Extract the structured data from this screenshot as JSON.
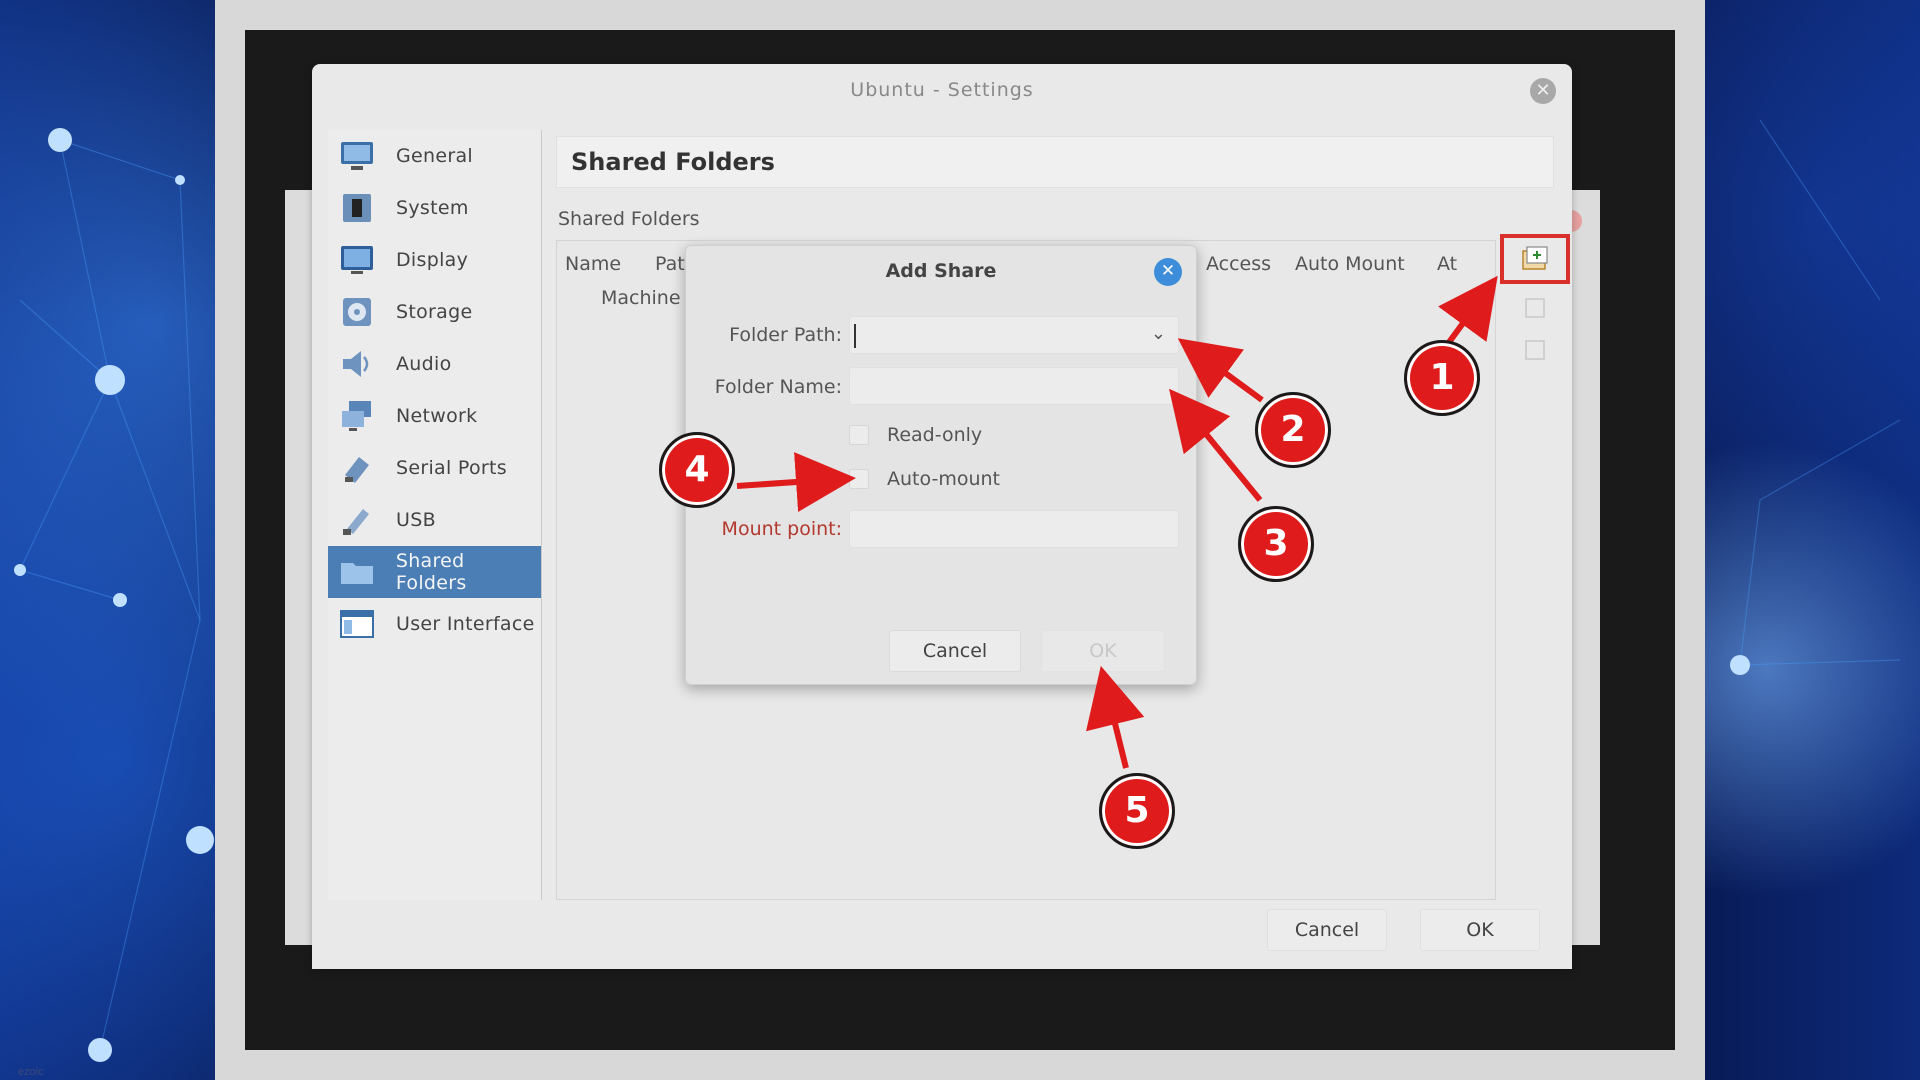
{
  "window": {
    "title": "Ubuntu - Settings",
    "close_icon": "close-icon"
  },
  "sidebar": {
    "items": [
      {
        "label": "General",
        "icon": "monitor-icon"
      },
      {
        "label": "System",
        "icon": "chip-icon"
      },
      {
        "label": "Display",
        "icon": "display-icon"
      },
      {
        "label": "Storage",
        "icon": "disk-icon"
      },
      {
        "label": "Audio",
        "icon": "speaker-icon"
      },
      {
        "label": "Network",
        "icon": "network-icon"
      },
      {
        "label": "Serial Ports",
        "icon": "serial-port-icon"
      },
      {
        "label": "USB",
        "icon": "usb-icon"
      },
      {
        "label": "Shared Folders",
        "icon": "folder-icon",
        "active": true
      },
      {
        "label": "User Interface",
        "icon": "window-icon"
      }
    ]
  },
  "main": {
    "header": "Shared Folders",
    "section_label": "Shared Folders",
    "table": {
      "columns": [
        "Name",
        "Pat",
        "Access",
        "Auto Mount",
        "At"
      ],
      "rows": [
        "Machine"
      ]
    },
    "tools": [
      "add-folder-icon",
      "edit-folder-icon",
      "remove-folder-icon"
    ]
  },
  "footer": {
    "cancel": "Cancel",
    "ok": "OK"
  },
  "dialog": {
    "title": "Add Share",
    "folder_path_label": "Folder Path:",
    "folder_path_value": "",
    "folder_name_label": "Folder Name:",
    "folder_name_value": "",
    "read_only_label": "Read-only",
    "auto_mount_label": "Auto-mount",
    "mount_point_label": "Mount point:",
    "mount_point_value": "",
    "cancel": "Cancel",
    "ok": "OK"
  },
  "annotations": {
    "color": "#e01b1b",
    "badges": [
      "1",
      "2",
      "3",
      "4",
      "5"
    ]
  },
  "watermark": "ezoic"
}
